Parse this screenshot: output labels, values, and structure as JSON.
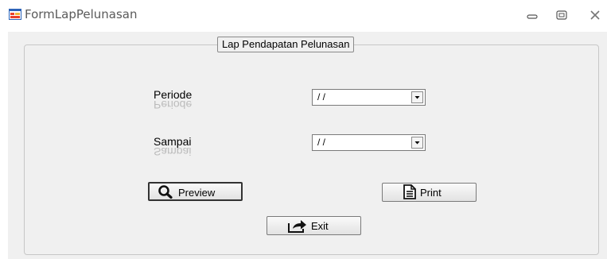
{
  "window": {
    "title": "FormLapPelunasan",
    "icon": "form-icon",
    "controls": [
      "minimize-icon",
      "maximize-icon",
      "close-icon"
    ]
  },
  "group": {
    "title": "Lap Pendapatan Pelunasan"
  },
  "fields": {
    "periode": {
      "label": "Periode",
      "value": "/ /"
    },
    "sampai": {
      "label": "Sampai",
      "value": "/ /"
    }
  },
  "buttons": {
    "preview": {
      "label": "Preview",
      "icon": "magnifier-icon"
    },
    "print": {
      "label": "Print",
      "icon": "document-icon"
    },
    "exit": {
      "label": "Exit",
      "icon": "exit-arrow-icon"
    }
  },
  "colors": {
    "background": "#f0f0f0",
    "titlebar": "#ffffff",
    "border": "#7a7a7a"
  }
}
